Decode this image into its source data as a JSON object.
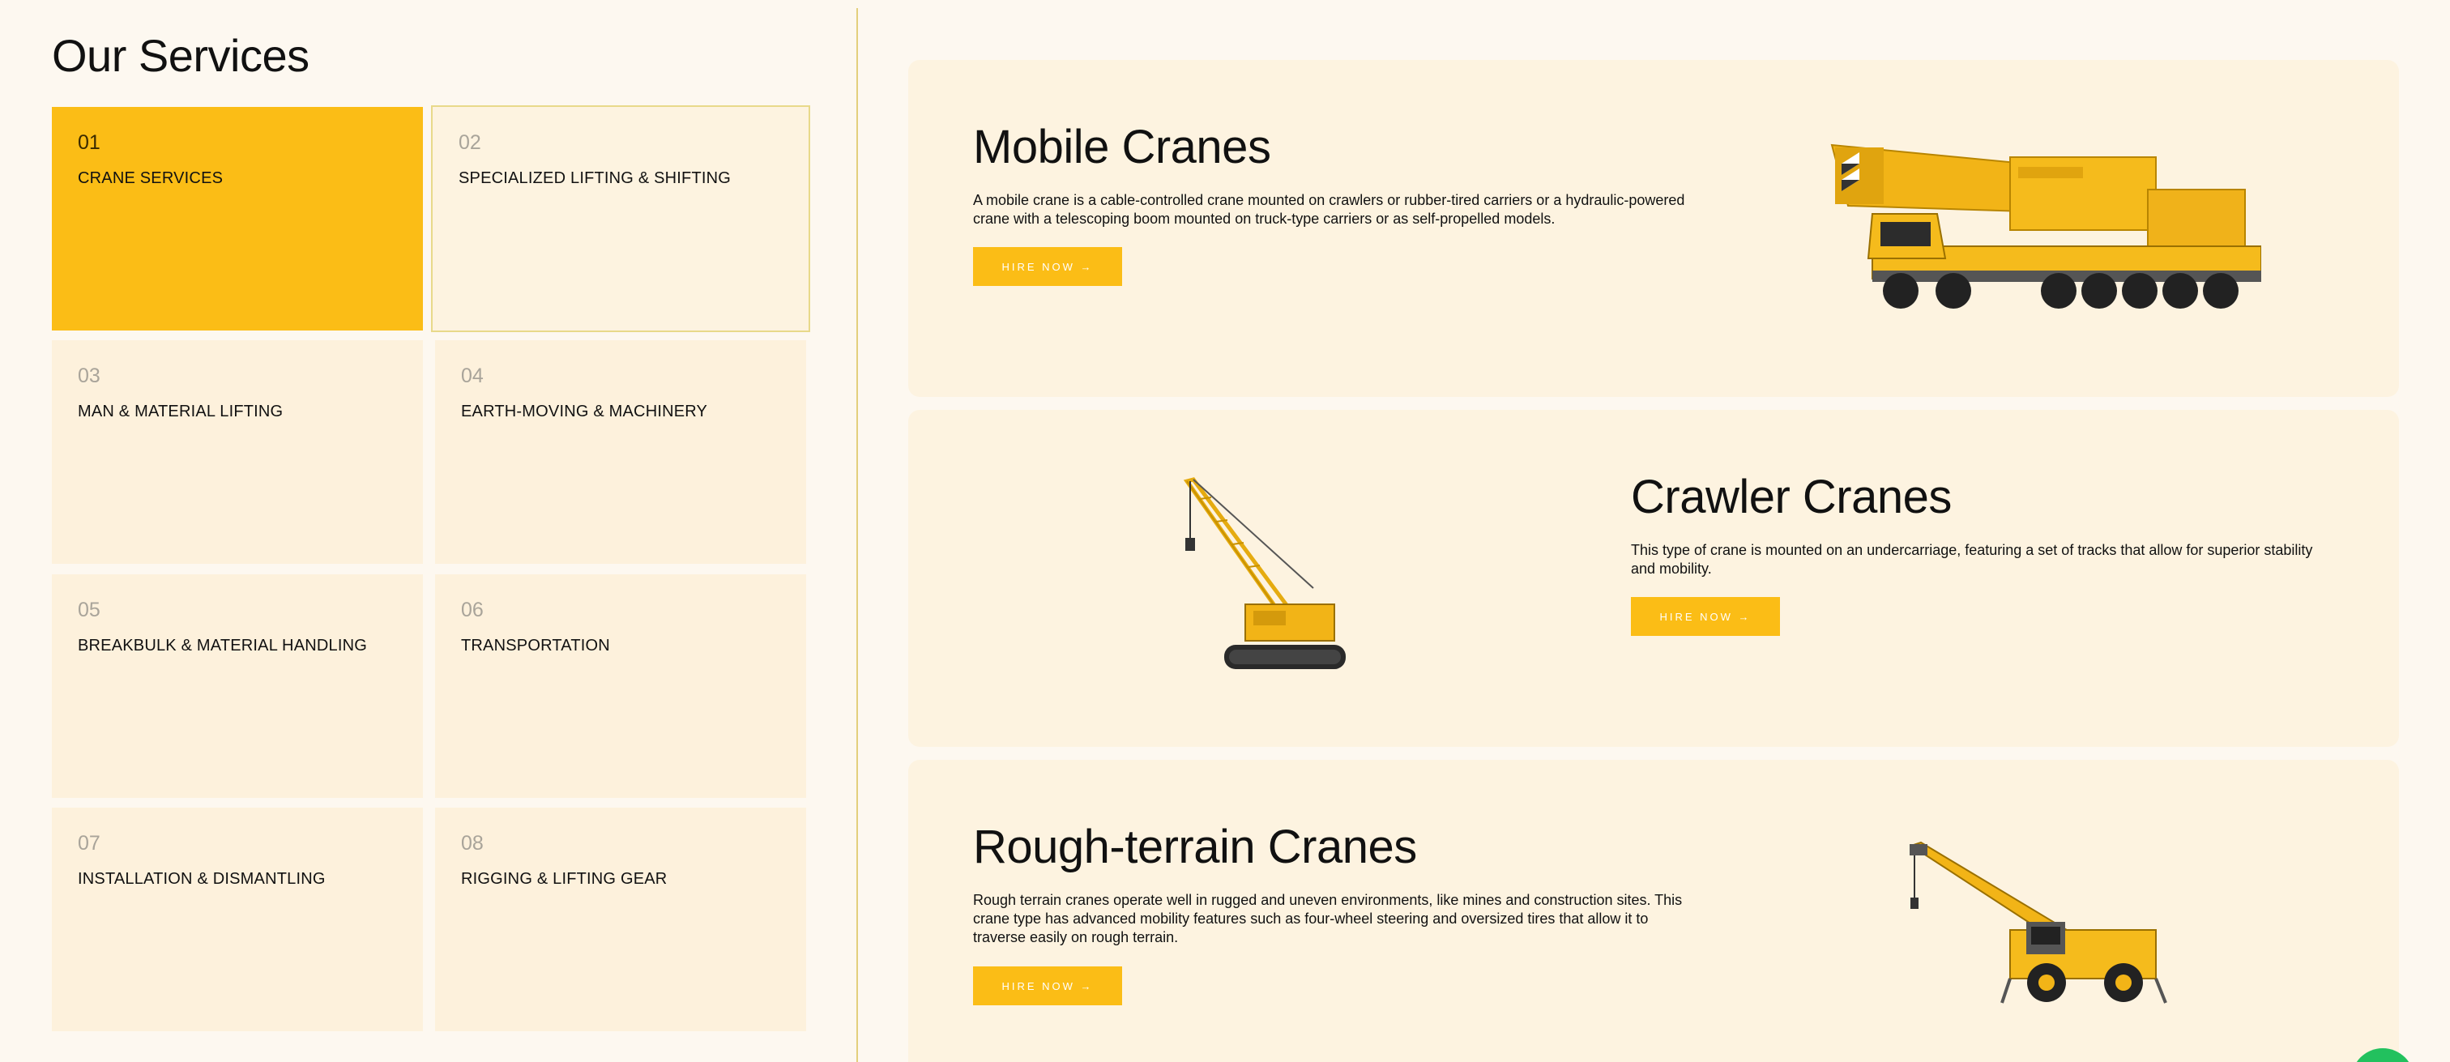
{
  "header": {
    "title": "Our Services"
  },
  "services": [
    {
      "num": "01",
      "label": "CRANE SERVICES"
    },
    {
      "num": "02",
      "label": "SPECIALIZED LIFTING & SHIFTING"
    },
    {
      "num": "03",
      "label": "MAN & MATERIAL LIFTING"
    },
    {
      "num": "04",
      "label": "EARTH-MOVING & MACHINERY"
    },
    {
      "num": "05",
      "label": "BREAKBULK & MATERIAL HANDLING"
    },
    {
      "num": "06",
      "label": "TRANSPORTATION"
    },
    {
      "num": "07",
      "label": "INSTALLATION & DISMANTLING"
    },
    {
      "num": "08",
      "label": "RIGGING & LIFTING GEAR"
    }
  ],
  "cranes": [
    {
      "title": "Mobile Cranes",
      "desc": "A mobile crane is a cable-controlled crane mounted on crawlers or rubber-tired carriers or a hydraulic-powered crane with a telescoping boom mounted on truck-type carriers or as self-propelled models.",
      "cta": "HIRE NOW →",
      "icon": "mobile-crane-image"
    },
    {
      "title": "Crawler Cranes",
      "desc": "This type of crane is mounted on an undercarriage, featuring a set of tracks that allow for superior stability and mobility.",
      "cta": "HIRE NOW →",
      "icon": "crawler-crane-image"
    },
    {
      "title": "Rough-terrain Cranes",
      "desc": "Rough terrain cranes operate well in rugged and uneven environments, like mines and construction sites. This crane type has advanced mobility features such as four-wheel steering and oversized tires that allow it to traverse easily on rough terrain.",
      "cta": "HIRE NOW →",
      "icon": "rough-terrain-crane-image"
    }
  ],
  "colors": {
    "accent": "#fbbd16",
    "background": "#fdf8f0",
    "tile": "#fdf1dc",
    "chat": "#22c15e"
  }
}
